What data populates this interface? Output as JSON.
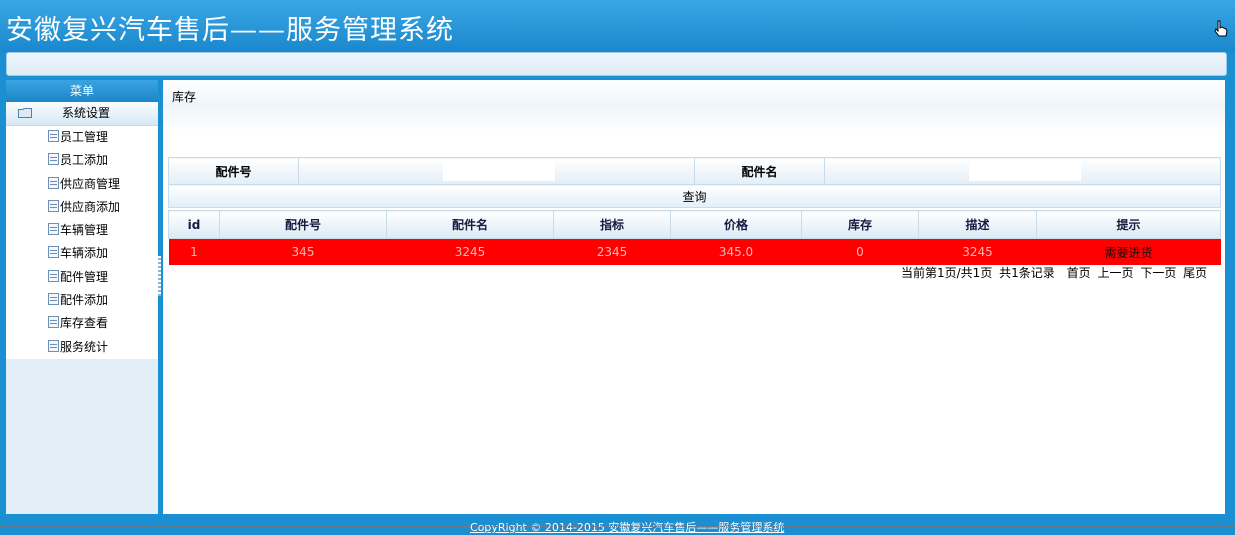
{
  "header": {
    "title": "安徽复兴汽车售后——服务管理系统"
  },
  "sidebar": {
    "menu_title": "菜单",
    "folder_label": "系统设置",
    "items": [
      {
        "label": "员工管理"
      },
      {
        "label": "员工添加"
      },
      {
        "label": "供应商管理"
      },
      {
        "label": "供应商添加"
      },
      {
        "label": "车辆管理"
      },
      {
        "label": "车辆添加"
      },
      {
        "label": "配件管理"
      },
      {
        "label": "配件添加"
      },
      {
        "label": "库存查看"
      },
      {
        "label": "服务统计"
      }
    ]
  },
  "main": {
    "breadcrumb": "库存",
    "search": {
      "part_no_label": "配件号",
      "part_no_value": "",
      "part_name_label": "配件名",
      "part_name_value": "",
      "query_label": "查询"
    },
    "table": {
      "headers": [
        "id",
        "配件号",
        "配件名",
        "指标",
        "价格",
        "库存",
        "描述",
        "提示"
      ],
      "rows": [
        {
          "id": "1",
          "part_no": "345",
          "part_name": "3245",
          "indicator": "2345",
          "price": "345.0",
          "stock": "0",
          "desc": "3245",
          "hint": "需要进货"
        }
      ],
      "row_color": "#ff0000"
    },
    "pager": {
      "summary": "当前第1页/共1页",
      "records": "共1条记录",
      "first": "首页",
      "prev": "上一页",
      "next": "下一页",
      "last": "尾页"
    }
  },
  "footer": {
    "copyright": "CopyRight © 2014-2015 安徽复兴汽车售后——服务管理系统"
  },
  "colors": {
    "primary": "#1a8fd2",
    "alert_row": "#ff0000"
  }
}
